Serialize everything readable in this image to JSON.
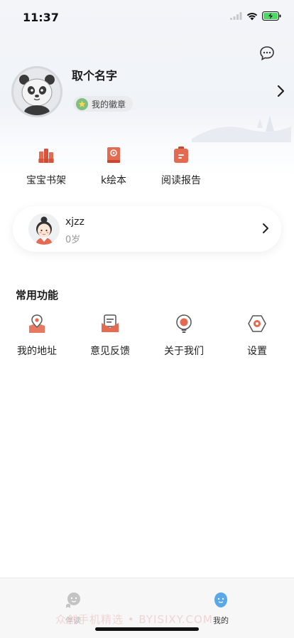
{
  "status_bar": {
    "time": "11:37"
  },
  "profile": {
    "nickname": "取个名字",
    "badge_label": "我的徽章"
  },
  "quick_links": [
    {
      "label": "宝宝书架",
      "icon": "bookshelf-icon"
    },
    {
      "label": "k绘本",
      "icon": "picture-book-icon"
    },
    {
      "label": "阅读报告",
      "icon": "report-icon"
    }
  ],
  "child": {
    "name": "xjzz",
    "age": "0岁"
  },
  "common": {
    "title": "常用功能",
    "items": [
      {
        "label": "我的地址",
        "icon": "location-icon"
      },
      {
        "label": "意见反馈",
        "icon": "feedback-icon"
      },
      {
        "label": "关于我们",
        "icon": "about-icon"
      },
      {
        "label": "设置",
        "icon": "settings-icon"
      }
    ]
  },
  "tabbar": {
    "tabs": [
      {
        "label": "伴读",
        "active": false
      },
      {
        "label": "我的",
        "active": true
      }
    ]
  },
  "watermark": "众创手机精选 • BYISIXY.COM",
  "colors": {
    "accent": "#e0604a",
    "tab_active": "#5aa8e8",
    "tab_inactive": "#b8b8b8"
  }
}
